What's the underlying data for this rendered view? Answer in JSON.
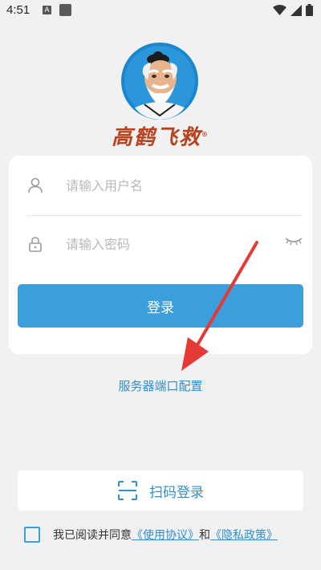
{
  "status_bar": {
    "time": "4:51",
    "notif_letter": "A"
  },
  "brand": {
    "name": "高鹤飞救",
    "registered": "®"
  },
  "login": {
    "username_placeholder": "请输入用户名",
    "password_placeholder": "请输入密码",
    "submit_label": "登录"
  },
  "server_config_link": "服务器端口配置",
  "scan_login_label": "扫码登录",
  "agreement": {
    "prefix": "我已阅读并同意",
    "terms_link": "《使用协议》",
    "conjunction": "和",
    "privacy_link": "《隐私政策》",
    "checked": false
  },
  "colors": {
    "accent": "#3a9fda",
    "link": "#2f8fd0",
    "brand": "#b8421e",
    "annotation_arrow": "#e53935"
  }
}
